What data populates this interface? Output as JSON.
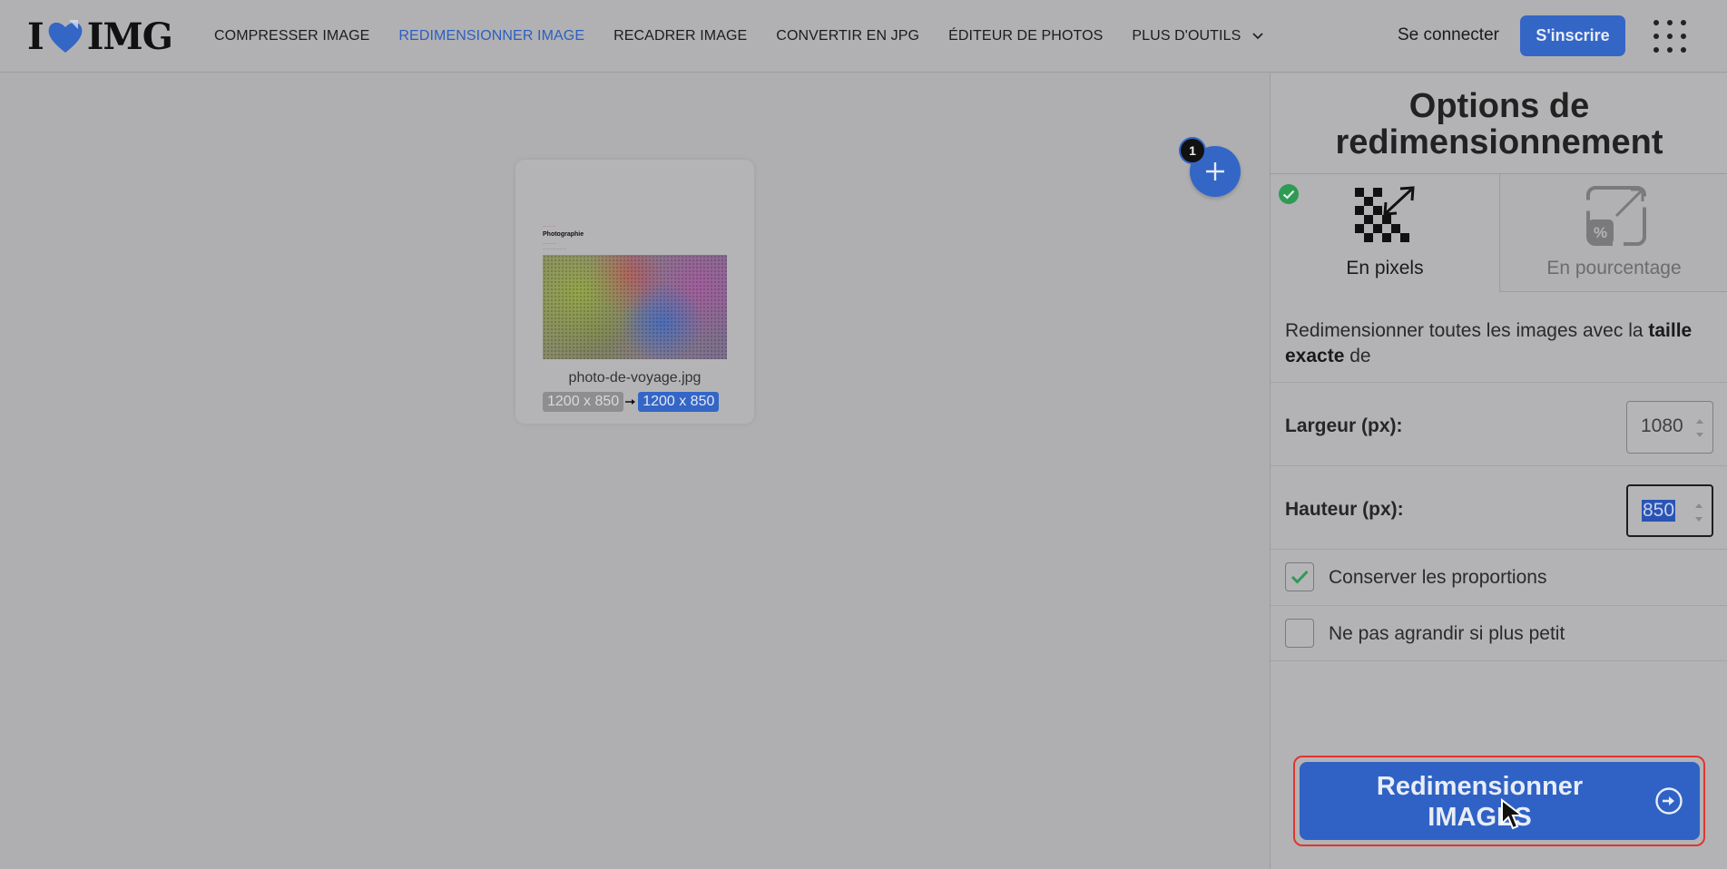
{
  "header": {
    "logo_left": "I",
    "logo_right": "IMG",
    "nav": [
      {
        "label": "COMPRESSER IMAGE"
      },
      {
        "label": "REDIMENSIONNER IMAGE"
      },
      {
        "label": "RECADRER IMAGE"
      },
      {
        "label": "CONVERTIR EN JPG"
      },
      {
        "label": "ÉDITEUR DE PHOTOS"
      },
      {
        "label": "PLUS D'OUTILS"
      }
    ],
    "login_label": "Se connecter",
    "signup_label": "S'inscrire"
  },
  "workspace": {
    "file": {
      "name": "photo-de-voyage.jpg",
      "original_size": "1200 x 850",
      "new_size": "1200 x 850",
      "thumb_title": "Photographie"
    },
    "file_count": "1"
  },
  "panel": {
    "title": "Options de redimensionnement",
    "modes": [
      {
        "label": "En pixels",
        "selected": true
      },
      {
        "label": "En pourcentage",
        "selected": false
      }
    ],
    "description_pre": "Redimensionner toutes les images avec la ",
    "description_bold": "taille exacte",
    "description_post": " de",
    "width_label": "Largeur (px):",
    "width_value": "1080",
    "height_label": "Hauteur (px):",
    "height_value": "850",
    "keep_ratio_label": "Conserver les proportions",
    "keep_ratio_checked": true,
    "no_enlarge_label": "Ne pas agrandir si plus petit",
    "no_enlarge_checked": false,
    "resize_line1": "Redimensionner",
    "resize_line2": "IMAGES"
  },
  "colors": {
    "accent": "#3466c6",
    "highlight_border": "#e0352f",
    "success": "#2f9a54"
  }
}
